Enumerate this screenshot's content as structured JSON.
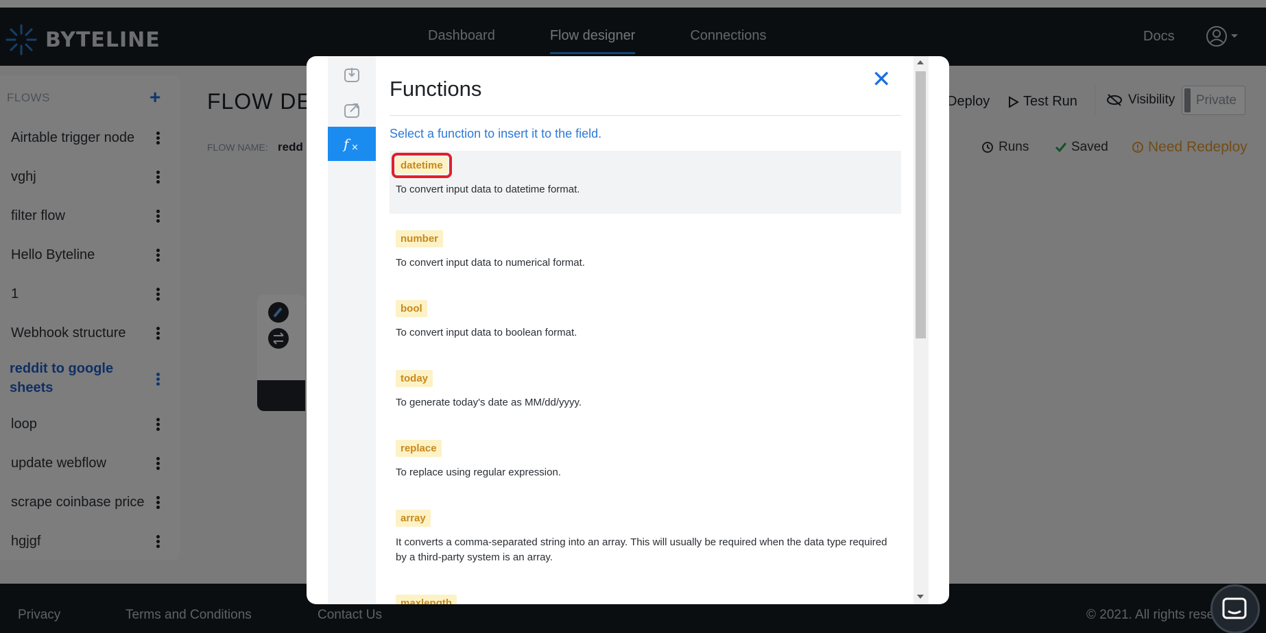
{
  "app": {
    "name": "BYTELINE"
  },
  "nav": {
    "links": [
      "Dashboard",
      "Flow designer",
      "Connections"
    ],
    "active": "Flow designer",
    "docs": "Docs"
  },
  "sidebar": {
    "heading": "FLOWS",
    "add": "+",
    "items": [
      {
        "label": "Airtable trigger node"
      },
      {
        "label": "vghj"
      },
      {
        "label": "filter flow"
      },
      {
        "label": "Hello Byteline"
      },
      {
        "label": "1"
      },
      {
        "label": "Webhook structure"
      },
      {
        "label": "reddit to google sheets"
      },
      {
        "label": "loop"
      },
      {
        "label": "update webflow"
      },
      {
        "label": "scrape coinbase price"
      },
      {
        "label": "hgjgf"
      }
    ],
    "active_item": "reddit to google sheets"
  },
  "main": {
    "title": "FLOW DES",
    "flow_name_label": "FLOW NAME:",
    "flow_name_value": "redd",
    "deploy": "Deploy",
    "test_run": "Test Run",
    "visibility": "Visibility",
    "private": "Private",
    "runs": "Runs",
    "saved": "Saved",
    "need_redeploy": "Need Redeploy"
  },
  "modal": {
    "title": "Functions",
    "subtitle": "Select a function to insert it to the field.",
    "functions": [
      {
        "name": "datetime",
        "desc": "To convert input data to datetime format."
      },
      {
        "name": "number",
        "desc": "To convert input data to numerical format."
      },
      {
        "name": "bool",
        "desc": "To convert input data to boolean format."
      },
      {
        "name": "today",
        "desc": "To generate today's date as MM/dd/yyyy."
      },
      {
        "name": "replace",
        "desc": "To replace using regular expression."
      },
      {
        "name": "array",
        "desc": "It converts a comma-separated string into an array. This will usually be required when the data type required by a third-party system is an array."
      },
      {
        "name": "maxlength",
        "desc": ""
      }
    ]
  },
  "footer": {
    "privacy": "Privacy",
    "terms": "Terms and Conditions",
    "contact": "Contact Us",
    "copyright": "© 2021. All rights rese"
  },
  "colors": {
    "accent": "#1a8cf0",
    "nav_bg": "#161c23",
    "warning": "#e39a2b",
    "highlight_box": "#e0202a"
  }
}
